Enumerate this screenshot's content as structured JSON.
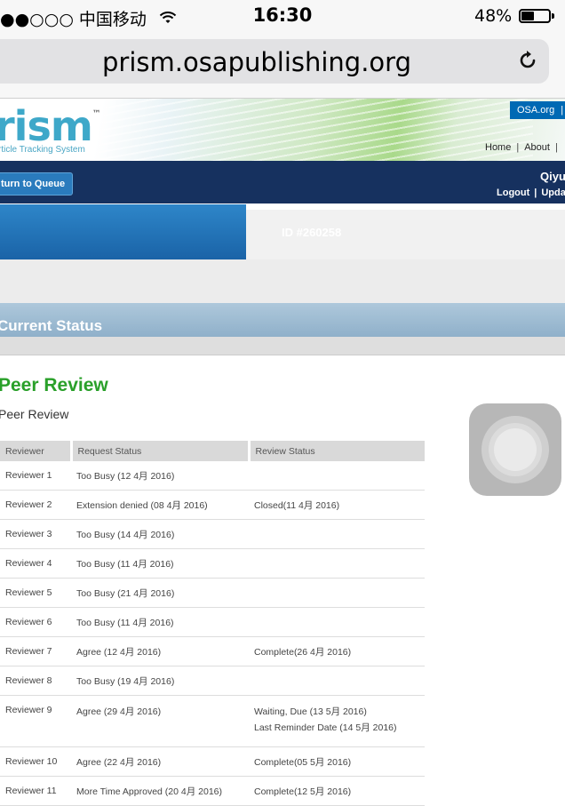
{
  "status_bar": {
    "carrier": "●●○○○ 中国移动",
    "time": "16:30",
    "battery": "48%",
    "battery_level": 0.48
  },
  "browser": {
    "url": "prism.osapublishing.org"
  },
  "header": {
    "logo": "rism",
    "logo_tm": "™",
    "tagline": "rticle Tracking System",
    "osa_link": "OSA.org",
    "links": [
      "Home",
      "About"
    ]
  },
  "nav": {
    "return_label": "turn to Queue",
    "user": "Qiyu",
    "logout": "Logout",
    "update": "Updat"
  },
  "manuscript": {
    "id": "ID #260258"
  },
  "current_status": {
    "title": "Current Status"
  },
  "peer_review": {
    "title": "Peer Review",
    "subtitle": "Peer Review",
    "columns": [
      "Reviewer",
      "Request Status",
      "Review Status"
    ],
    "rows": [
      {
        "reviewer": "Reviewer 1",
        "request": "Too Busy (12 4月 2016)",
        "review": ""
      },
      {
        "reviewer": "Reviewer 2",
        "request": "Extension denied (08 4月 2016)",
        "review": "Closed(11 4月 2016)"
      },
      {
        "reviewer": "Reviewer 3",
        "request": "Too Busy (14 4月 2016)",
        "review": ""
      },
      {
        "reviewer": "Reviewer 4",
        "request": "Too Busy (11 4月 2016)",
        "review": ""
      },
      {
        "reviewer": "Reviewer 5",
        "request": "Too Busy (21 4月 2016)",
        "review": ""
      },
      {
        "reviewer": "Reviewer 6",
        "request": "Too Busy (11 4月 2016)",
        "review": ""
      },
      {
        "reviewer": "Reviewer 7",
        "request": "Agree (12 4月 2016)",
        "review": "Complete(26 4月 2016)"
      },
      {
        "reviewer": "Reviewer 8",
        "request": "Too Busy (19 4月 2016)",
        "review": ""
      },
      {
        "reviewer": "Reviewer 9",
        "request": "Agree (29 4月 2016)",
        "review": "Waiting, Due (13 5月 2016)",
        "review2": "Last Reminder Date (14 5月 2016)"
      },
      {
        "reviewer": "Reviewer 10",
        "request": "Agree (22 4月 2016)",
        "review": "Complete(05 5月 2016)"
      },
      {
        "reviewer": "Reviewer 11",
        "request": "More Time Approved (20 4月 2016)",
        "review": "Complete(12 5月 2016)"
      }
    ]
  }
}
